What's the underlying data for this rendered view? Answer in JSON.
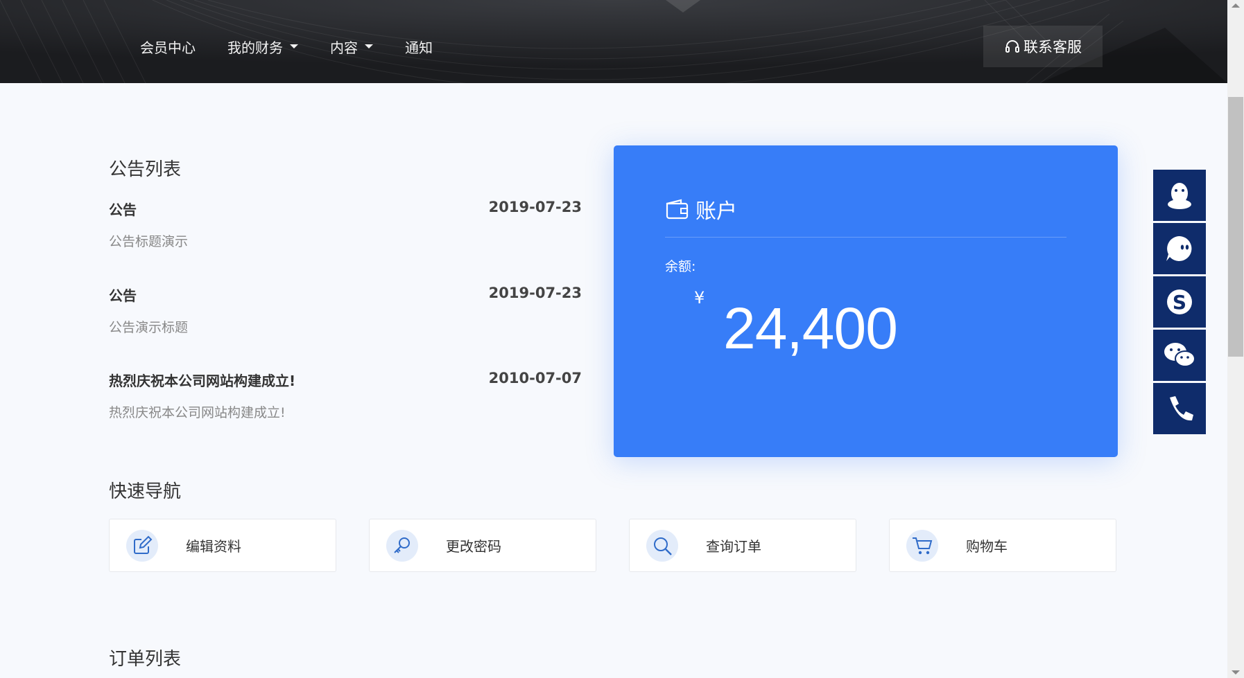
{
  "nav": {
    "items": [
      {
        "label": "会员中心",
        "has_dropdown": false
      },
      {
        "label": "我的财务",
        "has_dropdown": true
      },
      {
        "label": "内容",
        "has_dropdown": true
      },
      {
        "label": "通知",
        "has_dropdown": false
      }
    ],
    "contact_label": "联系客服"
  },
  "notices": {
    "title": "公告列表",
    "items": [
      {
        "title": "公告",
        "date": "2019-07-23",
        "subtitle": "公告标题演示"
      },
      {
        "title": "公告",
        "date": "2019-07-23",
        "subtitle": "公告演示标题"
      },
      {
        "title": "热烈庆祝本公司网站构建成立!",
        "date": "2010-07-07",
        "subtitle": "热烈庆祝本公司网站构建成立!"
      }
    ]
  },
  "account": {
    "title": "账户",
    "balance_label": "余额:",
    "currency": "¥",
    "balance": "24,400",
    "card_color": "#377df8"
  },
  "quick_nav": {
    "title": "快速导航",
    "items": [
      {
        "label": "编辑资料",
        "icon": "edit-icon"
      },
      {
        "label": "更改密码",
        "icon": "key-icon"
      },
      {
        "label": "查询订单",
        "icon": "search-icon"
      },
      {
        "label": "购物车",
        "icon": "cart-icon"
      }
    ]
  },
  "orders": {
    "title": "订单列表"
  },
  "float_bar": {
    "items": [
      "qq-icon",
      "aliwangwang-icon",
      "skype-icon",
      "wechat-icon",
      "phone-icon"
    ],
    "color": "#0f2c6b"
  }
}
